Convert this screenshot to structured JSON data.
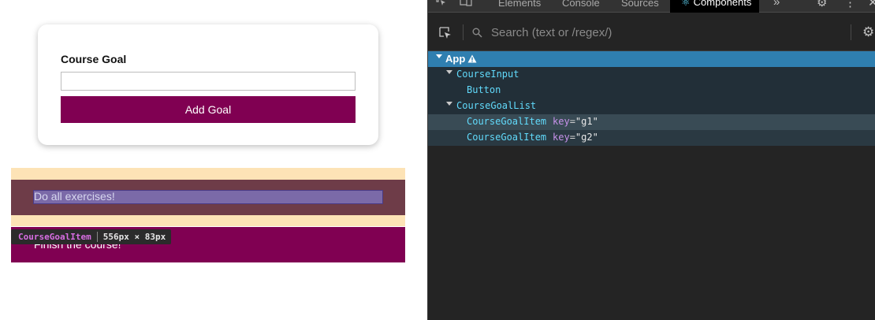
{
  "app": {
    "form": {
      "label": "Course Goal",
      "input_value": "",
      "button_label": "Add Goal"
    },
    "goals": [
      {
        "text": "Do all exercises!"
      },
      {
        "text": "Finish the course!"
      }
    ],
    "inspect_tooltip": {
      "component": "CourseGoalItem",
      "size": "556px × 83px"
    }
  },
  "devtools": {
    "tabs": [
      {
        "label": "Elements"
      },
      {
        "label": "Console"
      },
      {
        "label": "Sources"
      },
      {
        "label": "Components",
        "active": true
      }
    ],
    "more_tabs": "»",
    "search_placeholder": "Search (text or /regex/)",
    "tree": [
      {
        "name": "App",
        "depth": 0,
        "selected": true,
        "warning": true
      },
      {
        "name": "CourseInput",
        "depth": 1,
        "expanded": true
      },
      {
        "name": "Button",
        "depth": 2
      },
      {
        "name": "CourseGoalList",
        "depth": 1,
        "expanded": true
      },
      {
        "name": "CourseGoalItem",
        "depth": 2,
        "key_label": "key",
        "key_value": "\"g1\"",
        "hovered": true
      },
      {
        "name": "CourseGoalItem",
        "depth": 2,
        "key_label": "key",
        "key_value": "\"g2\""
      }
    ],
    "colors": {
      "selected_row": "#2f7fb0",
      "component_name": "#61dafb",
      "key_name": "#c792ea",
      "goal_item": "#800052",
      "highlight_margin": "#fde3b6"
    }
  }
}
